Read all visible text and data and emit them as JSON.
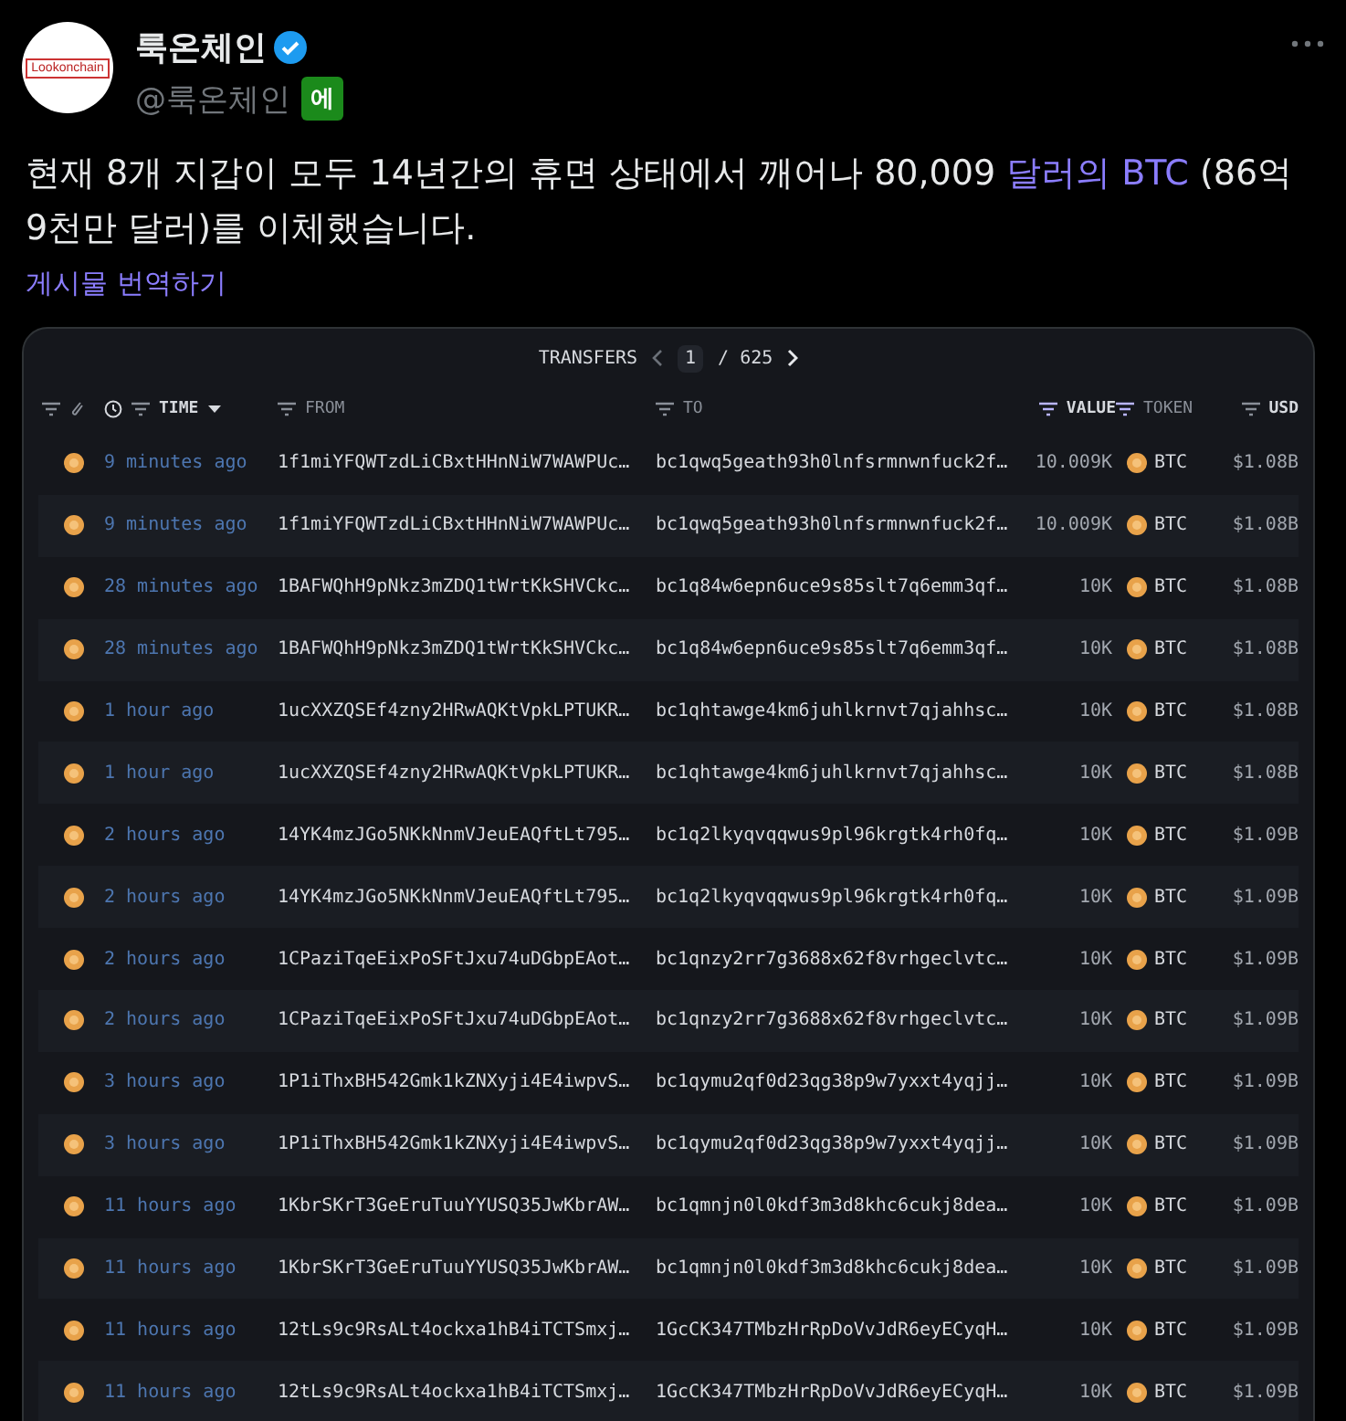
{
  "post": {
    "avatar_text": "Lookonchain",
    "name": "룩온체인",
    "verified": true,
    "handle": "@룩온체인",
    "handle_badge": "에",
    "text": [
      {
        "kind": "plain",
        "text": "현재 8개 지갑이 모두 14년간의 휴면 상태에서 깨어나 80,009 "
      },
      {
        "kind": "link",
        "text": "달러의 BTC"
      },
      {
        "kind": "plain",
        "text": " (86억 9천만 달러)를 이체했습니다."
      }
    ],
    "translate_link": "게시물 번역하기"
  },
  "transfers": {
    "title": "TRANSFERS",
    "page": "1",
    "page_total": "/ 625",
    "columns": [
      {
        "label": "TIME",
        "highlighted": true,
        "filtered": false
      },
      {
        "label": "FROM",
        "highlighted": false,
        "filtered": false
      },
      {
        "label": "TO",
        "highlighted": false,
        "filtered": false
      },
      {
        "label": "VALUE",
        "highlighted": true,
        "filtered": true
      },
      {
        "label": "TOKEN",
        "highlighted": false,
        "filtered": true
      },
      {
        "label": "USD",
        "highlighted": true,
        "filtered": false
      }
    ],
    "rows": [
      {
        "time": "9 minutes ago",
        "from": "1f1miYFQWTzdLiCBxtHHnNiW7WAWPUc…",
        "to": "bc1qwq5geath93h0lnfsrmnwnfuck2f…",
        "value": "10.009K",
        "token": "BTC",
        "usd": "$1.08B"
      },
      {
        "time": "9 minutes ago",
        "from": "1f1miYFQWTzdLiCBxtHHnNiW7WAWPUc…",
        "to": "bc1qwq5geath93h0lnfsrmnwnfuck2f…",
        "value": "10.009K",
        "token": "BTC",
        "usd": "$1.08B"
      },
      {
        "time": "28 minutes ago",
        "from": "1BAFWQhH9pNkz3mZDQ1tWrtKkSHVCkc…",
        "to": "bc1q84w6epn6uce9s85slt7q6emm3qf…",
        "value": "10K",
        "token": "BTC",
        "usd": "$1.08B"
      },
      {
        "time": "28 minutes ago",
        "from": "1BAFWQhH9pNkz3mZDQ1tWrtKkSHVCkc…",
        "to": "bc1q84w6epn6uce9s85slt7q6emm3qf…",
        "value": "10K",
        "token": "BTC",
        "usd": "$1.08B"
      },
      {
        "time": "1 hour ago",
        "from": "1ucXXZQSEf4zny2HRwAQKtVpkLPTUKR…",
        "to": "bc1qhtawge4km6juhlkrnvt7qjahhsc…",
        "value": "10K",
        "token": "BTC",
        "usd": "$1.08B"
      },
      {
        "time": "1 hour ago",
        "from": "1ucXXZQSEf4zny2HRwAQKtVpkLPTUKR…",
        "to": "bc1qhtawge4km6juhlkrnvt7qjahhsc…",
        "value": "10K",
        "token": "BTC",
        "usd": "$1.08B"
      },
      {
        "time": "2 hours ago",
        "from": "14YK4mzJGo5NKkNnmVJeuEAQftLt795…",
        "to": "bc1q2lkyqvqqwus9pl96krgtk4rh0fq…",
        "value": "10K",
        "token": "BTC",
        "usd": "$1.09B"
      },
      {
        "time": "2 hours ago",
        "from": "14YK4mzJGo5NKkNnmVJeuEAQftLt795…",
        "to": "bc1q2lkyqvqqwus9pl96krgtk4rh0fq…",
        "value": "10K",
        "token": "BTC",
        "usd": "$1.09B"
      },
      {
        "time": "2 hours ago",
        "from": "1CPaziTqeEixPoSFtJxu74uDGbpEAot…",
        "to": "bc1qnzy2rr7g3688x62f8vrhgeclvtc…",
        "value": "10K",
        "token": "BTC",
        "usd": "$1.09B"
      },
      {
        "time": "2 hours ago",
        "from": "1CPaziTqeEixPoSFtJxu74uDGbpEAot…",
        "to": "bc1qnzy2rr7g3688x62f8vrhgeclvtc…",
        "value": "10K",
        "token": "BTC",
        "usd": "$1.09B"
      },
      {
        "time": "3 hours ago",
        "from": "1P1iThxBH542Gmk1kZNXyji4E4iwpvS…",
        "to": "bc1qymu2qf0d23qg38p9w7yxxt4yqjj…",
        "value": "10K",
        "token": "BTC",
        "usd": "$1.09B"
      },
      {
        "time": "3 hours ago",
        "from": "1P1iThxBH542Gmk1kZNXyji4E4iwpvS…",
        "to": "bc1qymu2qf0d23qg38p9w7yxxt4yqjj…",
        "value": "10K",
        "token": "BTC",
        "usd": "$1.09B"
      },
      {
        "time": "11 hours ago",
        "from": "1KbrSKrT3GeEruTuuYYUSQ35JwKbrAW…",
        "to": "bc1qmnjn0l0kdf3m3d8khc6cukj8dea…",
        "value": "10K",
        "token": "BTC",
        "usd": "$1.09B"
      },
      {
        "time": "11 hours ago",
        "from": "1KbrSKrT3GeEruTuuYYUSQ35JwKbrAW…",
        "to": "bc1qmnjn0l0kdf3m3d8khc6cukj8dea…",
        "value": "10K",
        "token": "BTC",
        "usd": "$1.09B"
      },
      {
        "time": "11 hours ago",
        "from": "12tLs9c9RsALt4ockxa1hB4iTCTSmxj…",
        "to": "1GcCK347TMbzHrRpDoVvJdR6eyECyqH…",
        "value": "10K",
        "token": "BTC",
        "usd": "$1.09B"
      },
      {
        "time": "11 hours ago",
        "from": "12tLs9c9RsALt4ockxa1hB4iTCTSmxj…",
        "to": "1GcCK347TMbzHrRpDoVvJdR6eyECyqH…",
        "value": "10K",
        "token": "BTC",
        "usd": "$1.09B"
      }
    ]
  }
}
